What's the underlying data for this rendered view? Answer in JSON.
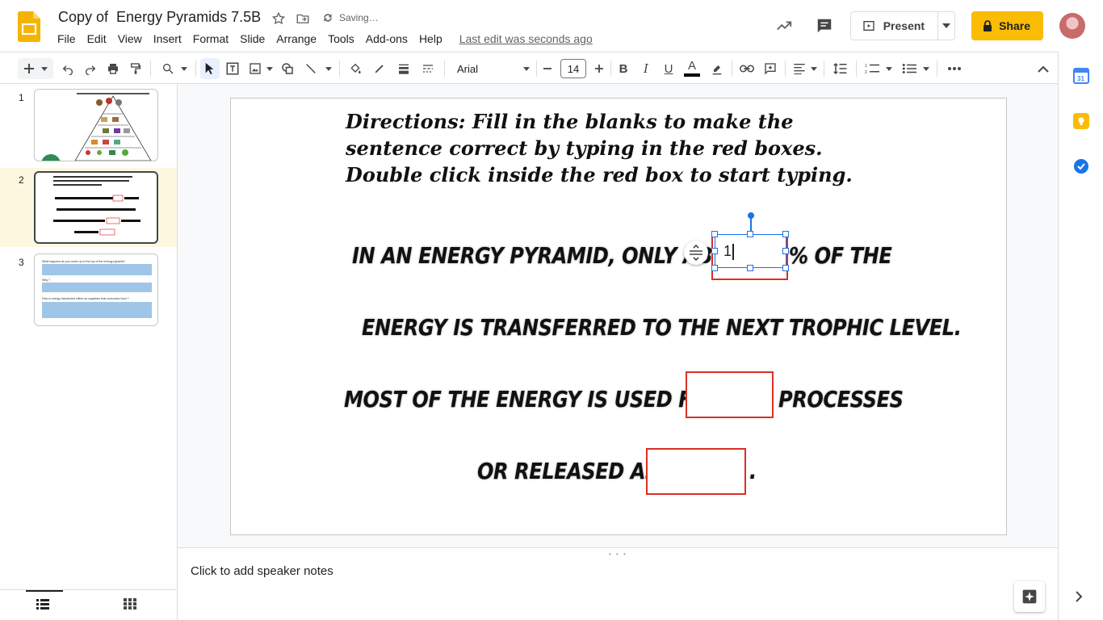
{
  "header": {
    "title": "Copy of  Energy Pyramids 7.5B",
    "saving": "Saving…",
    "menu": [
      "File",
      "Edit",
      "View",
      "Insert",
      "Format",
      "Slide",
      "Arrange",
      "Tools",
      "Add-ons",
      "Help"
    ],
    "last_edit": "Last edit was seconds ago",
    "present_label": "Present",
    "share_label": "Share"
  },
  "toolbar": {
    "font_name": "Arial",
    "font_size": "14"
  },
  "filmstrip": {
    "slides": [
      "1",
      "2",
      "3"
    ],
    "active": "2"
  },
  "slide": {
    "directions_bold": "Directions",
    "directions_text1": ": Fill in the blanks to make the sentence correct by typing in the red boxes. ",
    "directions_bold2": "Double click",
    "directions_text2": " inside the red box to start typing.",
    "line1_a": "IN AN ENERGY PYRAMID, ONLY ABOUT",
    "line1_b": "% OF THE",
    "line2": "ENERGY IS TRANSFERRED TO THE NEXT TROPHIC LEVEL.",
    "line3_a": "MOST OF THE ENERGY IS USED FOR",
    "line3_b": "PROCESSES",
    "line4_a": "OR RELEASED AS",
    "line4_b": ".",
    "typed_value": "1"
  },
  "thumb3": {
    "q1": "What happens as you move up to the top of the energy pyramid?",
    "q2": "Why ?",
    "q3": "How is energy transferred within an organism that consumes food ?"
  },
  "notes": {
    "placeholder": "Click to add speaker notes"
  },
  "colors": {
    "accent": "#fbbc04",
    "selection": "#1a73e8",
    "redbox": "#d93025",
    "active_slide_bg": "#fef7e0"
  }
}
